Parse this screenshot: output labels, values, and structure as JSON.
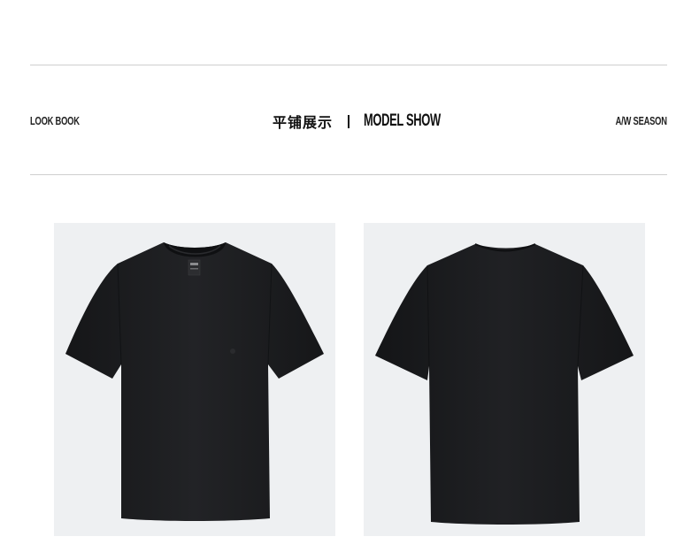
{
  "header": {
    "left_label": "LOOK BOOK",
    "title_cn": "平铺展示",
    "title_en": "MODEL SHOW",
    "right_label": "A/W SEASON"
  },
  "products": [
    {
      "view": "front",
      "icon": "black-tshirt-front-icon",
      "label_text": ""
    },
    {
      "view": "back",
      "icon": "black-tshirt-back-icon"
    }
  ],
  "colors": {
    "background": "#ffffff",
    "photo_background": "#eef0f2",
    "garment": "#1c1d1f",
    "rule": "#cfcfcf"
  }
}
